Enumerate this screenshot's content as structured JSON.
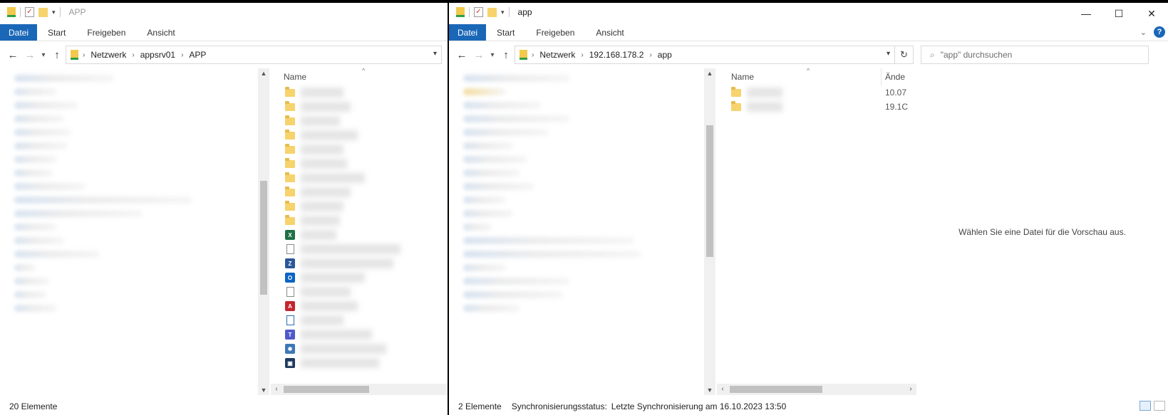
{
  "left": {
    "title": "APP",
    "ribbon": {
      "tabs": [
        "Datei",
        "Start",
        "Freigeben",
        "Ansicht"
      ]
    },
    "address": {
      "crumbs": [
        "Netzwerk",
        "appsrv01",
        "APP"
      ]
    },
    "column_name": "Name",
    "status": {
      "count": "20 Elemente"
    },
    "file_icons": [
      "folder",
      "folder",
      "folder",
      "folder",
      "folder",
      "folder",
      "folder",
      "folder",
      "folder",
      "folder",
      "excel-icon",
      "doc-icon",
      "zip-icon",
      "outlook-icon",
      "text-icon",
      "pdf-icon",
      "generic-app-icon",
      "teams-icon",
      "installer-icon",
      "remote-desktop-icon"
    ]
  },
  "right": {
    "title": "app",
    "ribbon": {
      "tabs": [
        "Datei",
        "Start",
        "Freigeben",
        "Ansicht"
      ]
    },
    "address": {
      "crumbs": [
        "Netzwerk",
        "192.168.178.2",
        "app"
      ]
    },
    "search_placeholder": "\"app\" durchsuchen",
    "columns": {
      "name": "Name",
      "date": "Ände"
    },
    "rows": [
      {
        "date": "10.07"
      },
      {
        "date": "19.1C"
      }
    ],
    "preview_text": "Wählen Sie eine Datei für die Vorschau aus.",
    "status": {
      "count": "2 Elemente",
      "sync_label": "Synchronisierungsstatus:",
      "sync_value": "Letzte Synchronisierung am 16.10.2023 13:50"
    }
  },
  "colors": {
    "accent": "#1a67b8",
    "folder": "#f6d36d"
  }
}
